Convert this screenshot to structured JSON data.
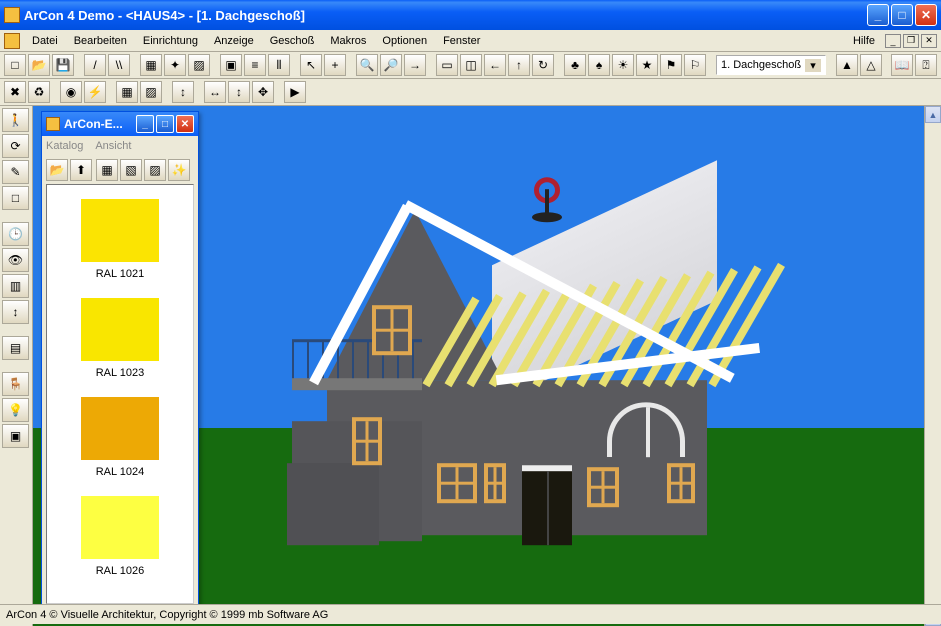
{
  "app": {
    "title": "ArCon  4 Demo - <HAUS4> - [1. Dachgeschoß]"
  },
  "menu": {
    "items": [
      "Datei",
      "Bearbeiten",
      "Einrichtung",
      "Anzeige",
      "Geschoß",
      "Makros",
      "Optionen",
      "Fenster"
    ],
    "help": "Hilfe"
  },
  "toolbar1": {
    "icons": [
      "new-icon",
      "open-icon",
      "save-icon",
      "line-icon",
      "line2-icon",
      "grid-icon",
      "sparkle-icon",
      "checker-icon",
      "block-icon",
      "hstripe-icon",
      "vstripe-icon",
      "cursor-icon",
      "plus-icon",
      "zoom-icon",
      "zoomout-icon",
      "arrow-r",
      "rect-icon",
      "split-icon",
      "arrow-l-icon",
      "arrow-u-icon",
      "rotate-icon",
      "tree1-icon",
      "tree2-icon",
      "sun-icon",
      "star-icon",
      "flag-icon",
      "flag2-icon"
    ],
    "glyphs": [
      "□",
      "📂",
      "💾",
      "/",
      "\\\\",
      "▦",
      "✦",
      "▨",
      "▣",
      "≡",
      "⦀",
      "↖",
      "+",
      "🔍",
      "🔎",
      "→",
      "▭",
      "◫",
      "←",
      "↑",
      "↻",
      "♣",
      "♠",
      "☀",
      "★",
      "⚑",
      "⚐"
    ],
    "dropdown_label": "1. Dachgeschoß",
    "right_icons": [
      "roof1-icon",
      "roof2-icon"
    ],
    "right_glyphs": [
      "▲",
      "△"
    ],
    "help_icons": [
      "book-icon",
      "whatsthis-icon"
    ],
    "help_glyphs": [
      "📖",
      "⍰"
    ]
  },
  "toolbar2": {
    "icons": [
      "stop-icon",
      "refresh-icon",
      "cam-icon",
      "energy-icon",
      "swatch-icon",
      "grid2-icon",
      "roll-icon",
      "harr-icon",
      "varr-icon",
      "expand-icon",
      "play-icon"
    ],
    "glyphs": [
      "✖",
      "♻",
      "◉",
      "⚡",
      "▦",
      "▨",
      "↕",
      "↔",
      "↕",
      "✥",
      "▶"
    ]
  },
  "sidebar": {
    "icons": [
      "walk-icon",
      "rotate3d-icon",
      "pencil-icon",
      "unknown-icon",
      "clock-icon",
      "eye-icon",
      "chart-icon",
      "height-icon",
      "blocks-icon",
      "chair-icon",
      "lamp-icon",
      "object-icon"
    ],
    "glyphs": [
      "🚶",
      "⟳",
      "✎",
      "□",
      "🕒",
      "👁",
      "▥",
      "↕",
      "▤",
      "🪑",
      "💡",
      "▣"
    ]
  },
  "panel": {
    "title": "ArCon-E...",
    "menu": [
      "Katalog",
      "Ansicht"
    ],
    "tool_icons": [
      "open-icon",
      "up-icon",
      "thumb1-icon",
      "thumb2-icon",
      "thumb3-icon",
      "wand-icon"
    ],
    "tool_glyphs": [
      "📂",
      "⬆",
      "▦",
      "▧",
      "▨",
      "✨"
    ],
    "swatches": [
      {
        "name": "RAL 1021",
        "color": "#fbe402"
      },
      {
        "name": "RAL 1023",
        "color": "#f9e600"
      },
      {
        "name": "RAL 1024",
        "color": "#eda905"
      },
      {
        "name": "RAL 1026",
        "color": "#fdff42"
      }
    ]
  },
  "status": {
    "text": "ArCon 4 © Visuelle Architektur, Copyright © 1999 mb Software AG"
  }
}
